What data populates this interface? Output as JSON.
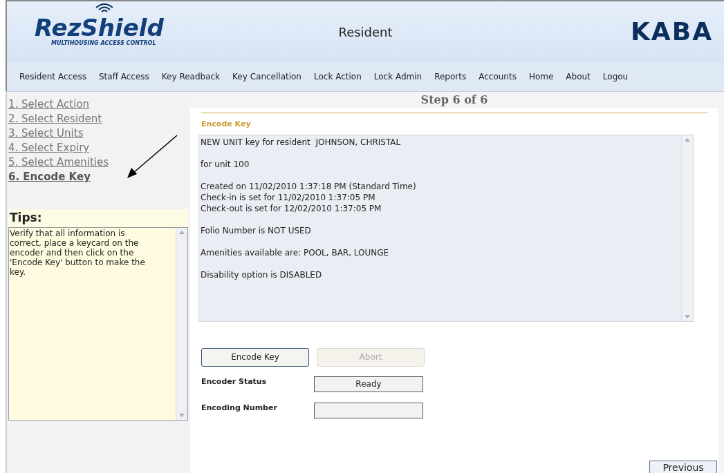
{
  "header": {
    "logo_text": "RezShield",
    "logo_tagline": "MULTIHOUSING ACCESS CONTROL",
    "title": "Resident",
    "brand": "KABA"
  },
  "nav": [
    "Resident Access",
    "Staff Access",
    "Key Readback",
    "Key Cancellation",
    "Lock Action",
    "Lock Admin",
    "Reports",
    "Accounts",
    "Home",
    "About",
    "Logou"
  ],
  "steps": [
    {
      "label": "1. Select Action",
      "selected": false
    },
    {
      "label": "2. Select Resident",
      "selected": false
    },
    {
      "label": "3. Select Units",
      "selected": false
    },
    {
      "label": "4. Select Expiry",
      "selected": false
    },
    {
      "label": "5. Select Amenities",
      "selected": false
    },
    {
      "label": "6. Encode Key",
      "selected": true
    }
  ],
  "tips": {
    "title": "Tips:",
    "text": "Verify that all information is correct, place a keycard on the encoder and then click on the 'Encode Key' button to make the key."
  },
  "main": {
    "step": "Step 6 of 6",
    "section": "Encode Key",
    "message": [
      [
        "NEW UNIT key for resident  JOHNSON, CHRISTAL"
      ],
      [
        "for unit 100"
      ],
      [
        "Created on 11/02/2010 1:37:18 PM (Standard Time)",
        "Check-in is set for 11/02/2010 1:37:05 PM",
        "Check-out is set for 12/02/2010 1:37:05 PM"
      ],
      [
        "Folio Number is NOT USED"
      ],
      [
        "Amenities available are: POOL, BAR, LOUNGE"
      ],
      [
        "Disability option is DISABLED"
      ]
    ],
    "buttons": [
      {
        "label": "Encode Key",
        "disabled": false
      },
      {
        "label": "Abort",
        "disabled": true
      }
    ],
    "fields": [
      {
        "label": "Encoder Status",
        "value": "Ready"
      },
      {
        "label": "Encoding Number"
      }
    ],
    "previous": "Previous"
  }
}
